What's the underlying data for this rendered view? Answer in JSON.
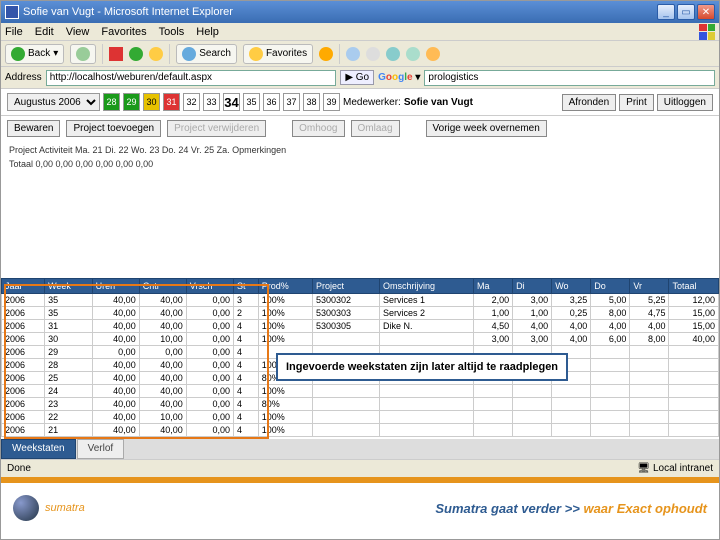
{
  "title": "Sofie van Vugt - Microsoft Internet Explorer",
  "menu": {
    "file": "File",
    "edit": "Edit",
    "view": "View",
    "favorites": "Favorites",
    "tools": "Tools",
    "help": "Help"
  },
  "toolbar": {
    "back": "Back",
    "search": "Search",
    "favorites": "Favorites"
  },
  "address": {
    "label": "Address",
    "url": "http://localhost/weburen/default.aspx",
    "go": "Go",
    "google_extra": "prologistics"
  },
  "top": {
    "month": "Augustus 2006",
    "days": [
      "28",
      "29",
      "30",
      "31",
      "32",
      "33",
      "34",
      "35",
      "36",
      "37",
      "38",
      "39"
    ],
    "medewerker_label": "Medewerker:",
    "medewerker": "Sofie van Vugt",
    "btn_afronden": "Afronden",
    "btn_print": "Print",
    "btn_uitloggen": "Uitloggen"
  },
  "actions": {
    "bewaren": "Bewaren",
    "project_toevoegen": "Project toevoegen",
    "project_verwijderen": "Project verwijderen",
    "omhoog": "Omhoog",
    "omlaag": "Omlaag",
    "vorige": "Vorige week overnemen"
  },
  "summary": {
    "line1": "Project Activiteit Ma. 21 Di. 22 Wo. 23 Do. 24 Vr. 25 Za.  Opmerkingen",
    "line2": "Totaal  0,00   0,00   0,00   0,00   0,00   0,00"
  },
  "grid": {
    "headers": [
      "Jaar",
      "Week",
      "Uren",
      "Cntr",
      "Vrsch",
      "St",
      "Prod%",
      "Project",
      "Omschrijving",
      "Ma",
      "Di",
      "Wo",
      "Do",
      "Vr",
      "Totaal"
    ],
    "left_rows": [
      [
        "2006",
        "35",
        "40,00",
        "40,00",
        "0,00",
        "3",
        "100%"
      ],
      [
        "2006",
        "35",
        "40,00",
        "40,00",
        "0,00",
        "2",
        "100%"
      ],
      [
        "2006",
        "31",
        "40,00",
        "40,00",
        "0,00",
        "4",
        "100%"
      ],
      [
        "2006",
        "30",
        "40,00",
        "10,00",
        "0,00",
        "4",
        "100%"
      ],
      [
        "2006",
        "29",
        "0,00",
        "0,00",
        "0,00",
        "4",
        ""
      ],
      [
        "2006",
        "28",
        "40,00",
        "40,00",
        "0,00",
        "4",
        "100%"
      ],
      [
        "2006",
        "25",
        "40,00",
        "40,00",
        "0,00",
        "4",
        "80%"
      ],
      [
        "2006",
        "24",
        "40,00",
        "40,00",
        "0,00",
        "4",
        "100%"
      ],
      [
        "2006",
        "23",
        "40,00",
        "40,00",
        "0,00",
        "4",
        "80%"
      ],
      [
        "2006",
        "22",
        "40,00",
        "10,00",
        "0,00",
        "4",
        "100%"
      ],
      [
        "2006",
        "21",
        "40,00",
        "40,00",
        "0,00",
        "4",
        "100%"
      ]
    ],
    "right_rows": [
      [
        "5300302",
        "Services 1",
        "2,00",
        "3,00",
        "3,25",
        "5,00",
        "5,25",
        "12,00"
      ],
      [
        "5300303",
        "Services 2",
        "1,00",
        "1,00",
        "0,25",
        "8,00",
        "4,75",
        "15,00"
      ],
      [
        "5300305",
        "Dike N.",
        "4,50",
        "4,00",
        "4,00",
        "4,00",
        "4,00",
        "15,00"
      ],
      [
        "",
        "",
        "3,00",
        "3,00",
        "4,00",
        "6,00",
        "8,00",
        "40,00"
      ]
    ]
  },
  "callout": "Ingevoerde weekstaten zijn later altijd te raadplegen",
  "tabs": {
    "weekstaten": "Weekstaten",
    "verlof": "Verlof"
  },
  "status": {
    "done": "Done",
    "zone": "Local intranet"
  },
  "footer": {
    "brand": "sumatra",
    "slogan_a": "Sumatra gaat verder >> ",
    "slogan_b": "waar Exact ophoudt"
  }
}
